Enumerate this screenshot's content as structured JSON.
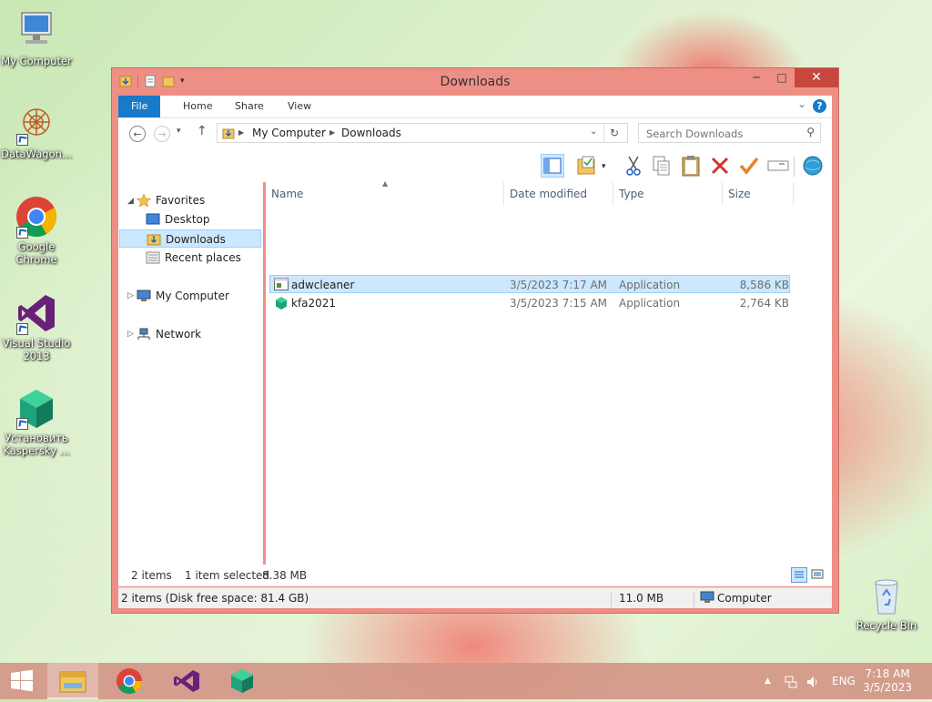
{
  "desktop": {
    "icons": [
      {
        "label": "My Computer"
      },
      {
        "label": "DataWagon..."
      },
      {
        "label": "Google Chrome"
      },
      {
        "label": "Visual Studio 2013"
      },
      {
        "label": "Установить Kaspersky ..."
      },
      {
        "label": "Recycle Bin"
      }
    ]
  },
  "window": {
    "title": "Downloads",
    "controls": {
      "minimize": "─",
      "maximize": "□",
      "close": "✕"
    },
    "ribbon": {
      "tabs": [
        "File",
        "Home",
        "Share",
        "View"
      ],
      "help": "?"
    },
    "address": {
      "crumbs": [
        "My Computer",
        "Downloads"
      ],
      "search_placeholder": "Search Downloads"
    },
    "navpane": {
      "favorites": "Favorites",
      "favorites_items": [
        "Desktop",
        "Downloads",
        "Recent places"
      ],
      "my_computer": "My Computer",
      "network": "Network",
      "selected": "Downloads"
    },
    "columns": [
      "Name",
      "Date modified",
      "Type",
      "Size"
    ],
    "files": [
      {
        "name": "adwcleaner",
        "date": "3/5/2023 7:17 AM",
        "type": "Application",
        "size": "8,586 KB",
        "selected": true
      },
      {
        "name": "kfa2021",
        "date": "3/5/2023 7:15 AM",
        "type": "Application",
        "size": "2,764 KB",
        "selected": false
      }
    ],
    "status": {
      "items": "2 items",
      "selected": "1 item selected",
      "selected_size": "8.38 MB"
    },
    "details_bar": {
      "left": "2 items (Disk free space: 81.4 GB)",
      "size": "11.0 MB",
      "location": "Computer"
    }
  },
  "taskbar": {
    "tray_lang": "ENG",
    "time": "7:18 AM",
    "date": "3/5/2023"
  },
  "colors": {
    "window_frame": "#ee8f85",
    "close_button": "#c7463e",
    "file_tab": "#1979ca",
    "selection": "#cce8ff"
  }
}
